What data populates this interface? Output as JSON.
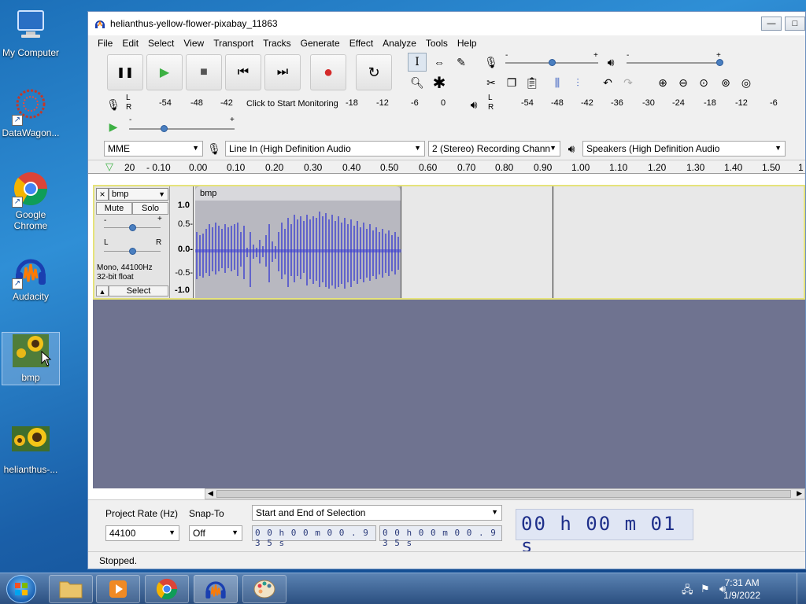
{
  "desktop": {
    "icons": [
      {
        "label": "My Computer"
      },
      {
        "label": "DataWagon..."
      },
      {
        "label": "Google Chrome"
      },
      {
        "label": "Audacity"
      },
      {
        "label": "bmp"
      },
      {
        "label": "helianthus-..."
      }
    ]
  },
  "window": {
    "title": "helianthus-yellow-flower-pixabay_11863",
    "controls": {
      "minimize": "—",
      "maximize": "□"
    }
  },
  "menu": [
    "File",
    "Edit",
    "Select",
    "View",
    "Transport",
    "Tracks",
    "Generate",
    "Effect",
    "Analyze",
    "Tools",
    "Help"
  ],
  "transport": {
    "pause": "❚❚",
    "play": "▶",
    "stop": "■",
    "skip_start": "⏮",
    "skip_end": "⏭",
    "record": "●",
    "loop": "↻"
  },
  "meters": {
    "record_L": "L",
    "record_R": "R",
    "record_ticks": [
      "-54",
      "-48",
      "-42",
      "-18",
      "-12",
      "-6",
      "0"
    ],
    "monitor_text": "Click to Start Monitoring",
    "play_L": "L",
    "play_R": "R",
    "play_ticks": [
      "-54",
      "-48",
      "-42",
      "-36",
      "-30",
      "-24",
      "-18",
      "-12",
      "-6"
    ]
  },
  "sliders": {
    "minus": "-",
    "plus": "+"
  },
  "device": {
    "host": "MME",
    "input": "Line In (High Definition Audio",
    "channels": "2 (Stereo) Recording Chann",
    "output": "Speakers (High Definition Audio"
  },
  "timeline": {
    "ticks": [
      "20",
      "- 0.10",
      "0.00",
      "0.10",
      "0.20",
      "0.30",
      "0.40",
      "0.50",
      "0.60",
      "0.70",
      "0.80",
      "0.90",
      "1.00",
      "1.10",
      "1.20",
      "1.30",
      "1.40",
      "1.50",
      "1"
    ]
  },
  "track": {
    "name": "bmp",
    "close": "×",
    "mute": "Mute",
    "solo": "Solo",
    "gain_minus": "-",
    "gain_plus": "+",
    "pan_L": "L",
    "pan_R": "R",
    "info_line1": "Mono, 44100Hz",
    "info_line2": "32-bit float",
    "select": "Select",
    "collapse": "▲",
    "clip_name": "bmp",
    "scale": [
      "1.0",
      "0.5-",
      "0.0-",
      "-0.5-",
      "-1.0"
    ]
  },
  "selection": {
    "rate_label": "Project Rate (Hz)",
    "rate_value": "44100",
    "snap_label": "Snap-To",
    "snap_value": "Off",
    "mode": "Start and End of Selection",
    "start_time": "0 0 h 0 0 m 0 0 . 9 3 5 s",
    "end_time": "0 0 h 0 0 m 0 0 . 9 3 5 s",
    "audio_position": "00 h 00 m 01 s"
  },
  "status": "Stopped.",
  "taskbar": {
    "time": "7:31 AM",
    "date": "1/9/2022"
  },
  "colors": {
    "waveform": "#3c3fd0",
    "track_border": "#e6e37a",
    "record": "#d42a2a",
    "play": "#3cb043"
  }
}
